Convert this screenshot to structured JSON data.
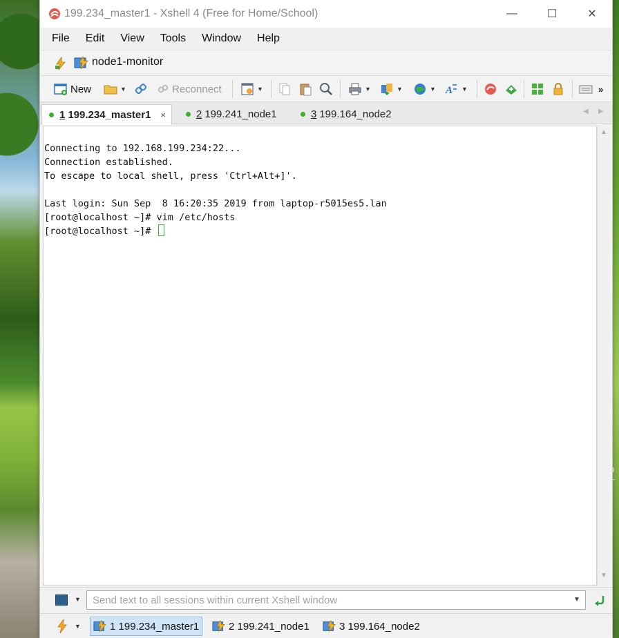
{
  "window": {
    "title": "199.234_master1 - Xshell 4 (Free for Home/School)",
    "controls": {
      "minimize": "—",
      "maximize": "☐",
      "close": "✕"
    }
  },
  "menu": [
    "File",
    "Edit",
    "View",
    "Tools",
    "Window",
    "Help"
  ],
  "address": {
    "session_name": "node1-monitor"
  },
  "toolbar": {
    "new_label": "New",
    "reconnect_label": "Reconnect"
  },
  "tabs": [
    {
      "number": "1",
      "label": "199.234_master1",
      "active": true,
      "close": "×"
    },
    {
      "number": "2",
      "label": "199.241_node1",
      "active": false
    },
    {
      "number": "3",
      "label": "199.164_node2",
      "active": false
    }
  ],
  "terminal": {
    "lines": [
      "Connecting to 192.168.199.234:22...",
      "Connection established.",
      "To escape to local shell, press 'Ctrl+Alt+]'.",
      "",
      "Last login: Sun Sep  8 16:20:35 2019 from laptop-r5015es5.lan",
      "[root@localhost ~]# vim /etc/hosts"
    ],
    "prompt": "[root@localhost ~]# "
  },
  "compose": {
    "placeholder": "Send text to all sessions within current Xshell window"
  },
  "sessions": [
    {
      "label": "1 199.234_master1",
      "active": true
    },
    {
      "label": "2 199.241_node1",
      "active": false
    },
    {
      "label": "3 199.164_node2",
      "active": false
    }
  ],
  "desktop_edge_text": "9\nT",
  "colors": {
    "status_dot": "#3fae2a",
    "cursor": "#22c422",
    "session_active_bg": "#cfe4f7"
  }
}
